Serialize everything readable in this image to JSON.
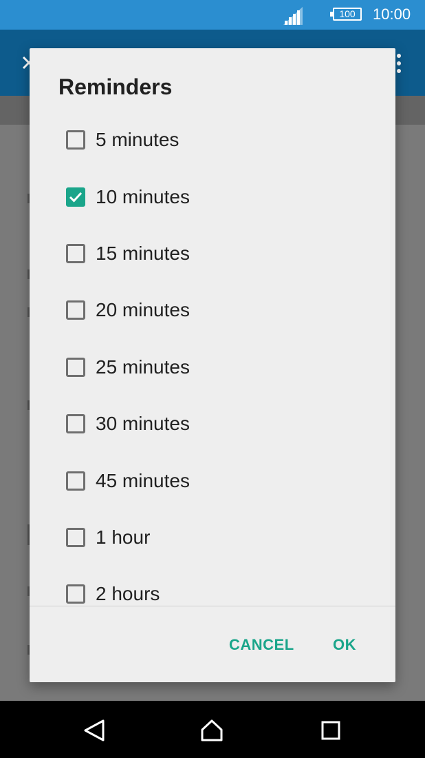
{
  "status_bar": {
    "battery_level": "100",
    "time": "10:00",
    "signal_icon": "signal-icon",
    "background_color": "#2b8ed0"
  },
  "app_bar": {
    "close_icon": "close-icon",
    "overflow_icon": "overflow-menu-icon",
    "background_color": "#0d5b8c"
  },
  "dialog": {
    "title": "Reminders",
    "options": [
      {
        "label": "5 minutes",
        "checked": false
      },
      {
        "label": "10 minutes",
        "checked": true
      },
      {
        "label": "15 minutes",
        "checked": false
      },
      {
        "label": "20 minutes",
        "checked": false
      },
      {
        "label": "25 minutes",
        "checked": false
      },
      {
        "label": "30 minutes",
        "checked": false
      },
      {
        "label": "45 minutes",
        "checked": false
      },
      {
        "label": "1 hour",
        "checked": false
      },
      {
        "label": "2 hours",
        "checked": false
      }
    ],
    "cancel_label": "CANCEL",
    "ok_label": "OK",
    "accent_color": "#1aa58a"
  },
  "nav_bar": {
    "back_icon": "back-icon",
    "home_icon": "home-icon",
    "recents_icon": "recents-icon"
  }
}
